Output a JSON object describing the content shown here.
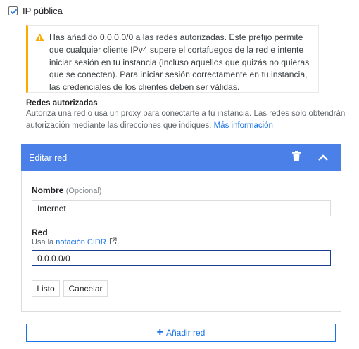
{
  "public_ip": {
    "label": "IP pública",
    "checked": true
  },
  "warning": {
    "icon": "warning-icon",
    "text": "Has añadido 0.0.0.0/0 a las redes autorizadas. Este prefijo permite que cualquier cliente IPv4 supere el cortafuegos de la red e intente iniciar sesión en tu instancia (incluso aquellos que quizás no quieras que se conecten). Para iniciar sesión correctamente en tu instancia, las credenciales de los clientes deben ser válidas.",
    "accent_color": "#f9ab00"
  },
  "authorized_networks": {
    "title": "Redes autorizadas",
    "description": "Autoriza una red o usa un proxy para conectarte a tu instancia. Las redes solo obtendrán autorización mediante las direcciones que indiques.",
    "more_info_link": "Más información"
  },
  "edit_network": {
    "title": "Editar red",
    "header_color": "#4a80e8",
    "icons": [
      "trash-icon",
      "chevron-up-icon"
    ],
    "name_label": "Nombre",
    "name_optional": "(Opcional)",
    "name_value": "Internet",
    "network_label": "Red",
    "cidr_hint_prefix": "Usa la",
    "cidr_hint_link": "notación CIDR",
    "cidr_hint_suffix": ".",
    "network_value": "0.0.0.0/0",
    "done_button": "Listo",
    "cancel_button": "Cancelar"
  },
  "add_network": {
    "label": "Añadir red",
    "icon": "plus-icon"
  },
  "colors": {
    "link": "#1a73e8",
    "text": "#202124"
  }
}
